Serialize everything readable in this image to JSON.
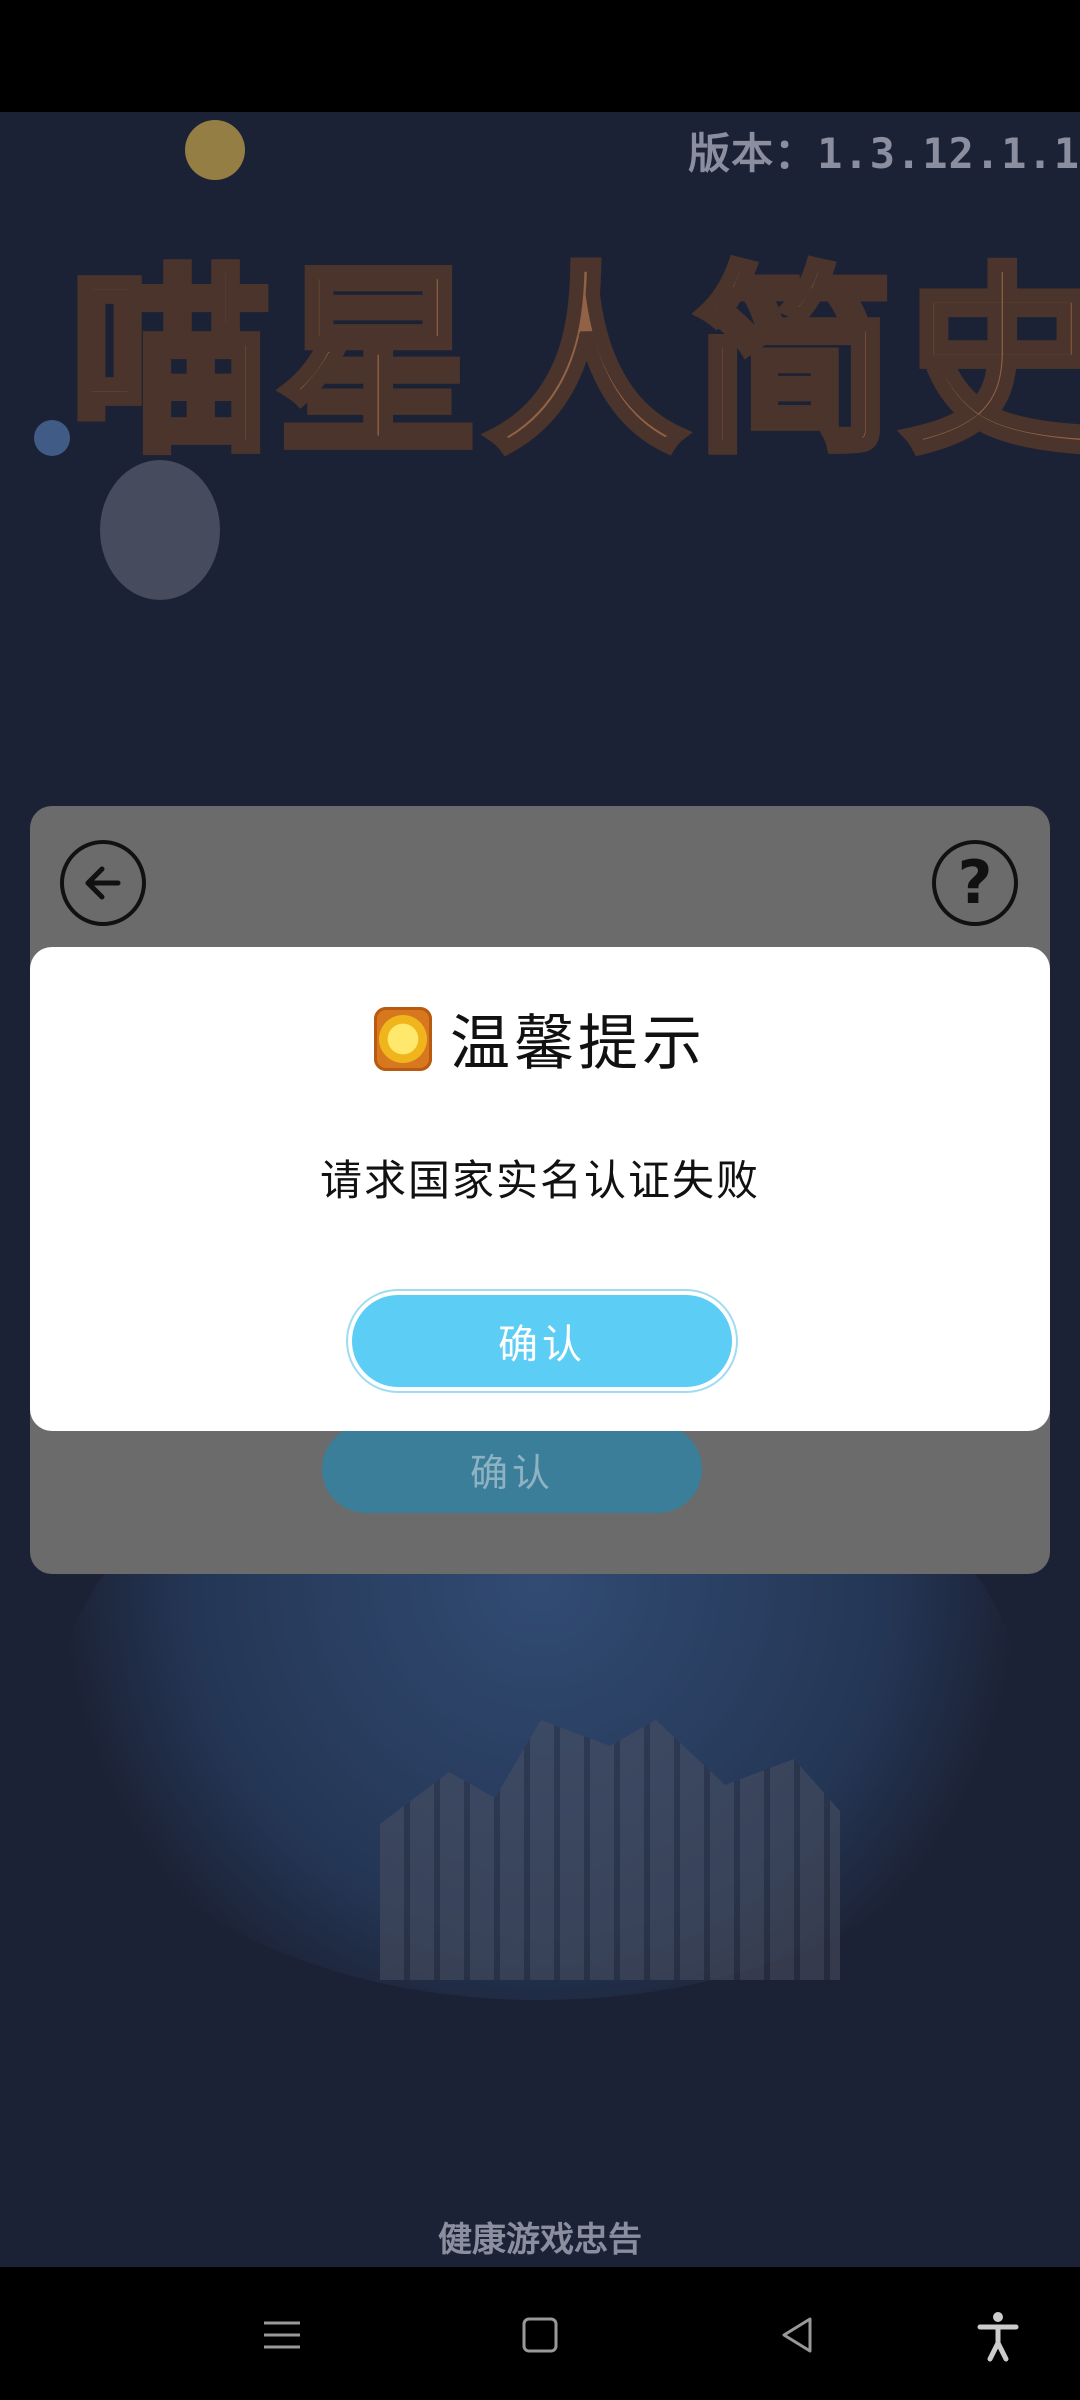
{
  "app": {
    "version_text": "版本：1.3.12.1.1",
    "logo_text": "喵星人简史",
    "health_notice": "健康游戏忠告"
  },
  "panel": {
    "back_icon": "arrow-left-icon",
    "help_icon": "question-icon",
    "help_glyph": "?",
    "confirm_label": "确认"
  },
  "dialog": {
    "title": "温馨提示",
    "title_icon": "coin-icon",
    "message": "请求国家实名认证失败",
    "confirm_label": "确认"
  },
  "nav_bar": {
    "menu_icon": "menu-icon",
    "home_icon": "home-icon",
    "back_icon": "back-triangle-icon",
    "accessibility_icon": "accessibility-icon"
  },
  "colors": {
    "background": "#1c2236",
    "dialog_button": "#5ccdf5",
    "panel_overlay": "#6b6b6b"
  }
}
